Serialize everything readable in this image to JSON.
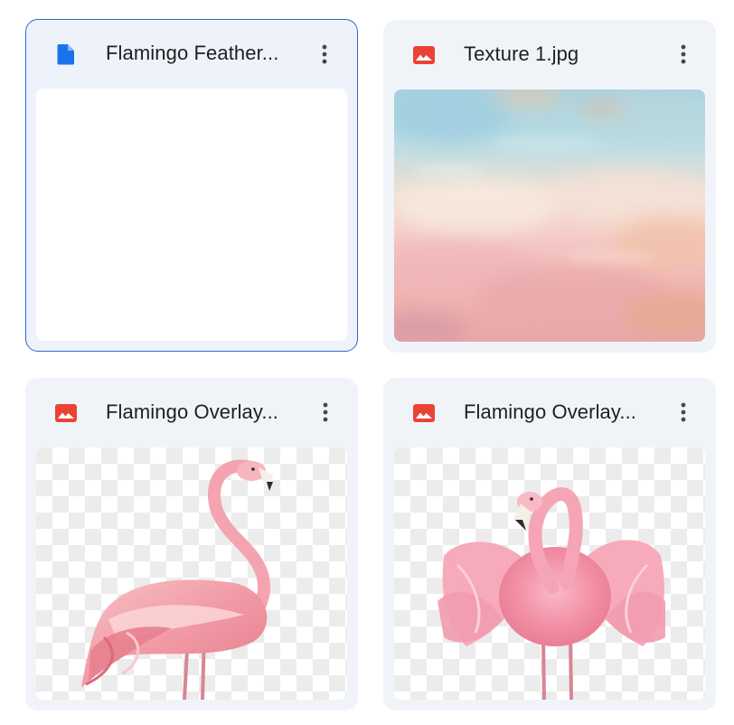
{
  "files": [
    {
      "name": "Flamingo Feather...",
      "type": "document",
      "icon": "doc-icon",
      "selected": true
    },
    {
      "name": "Texture 1.jpg",
      "type": "image",
      "icon": "image-icon",
      "selected": false
    },
    {
      "name": "Flamingo Overlay...",
      "type": "image",
      "icon": "image-icon",
      "selected": false
    },
    {
      "name": "Flamingo Overlay...",
      "type": "image",
      "icon": "image-icon",
      "selected": false
    }
  ],
  "more_icon": "more-vert-icon",
  "colors": {
    "doc_blue": "#1a73e8",
    "image_red": "#ea4335",
    "card_bg": "#f0f4f9",
    "selected_border": "#2f66d0",
    "flamingo_pink": "#f07f96"
  }
}
